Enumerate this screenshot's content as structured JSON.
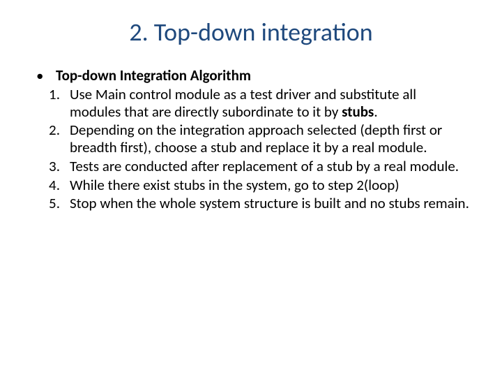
{
  "title": "2. Top-down integration",
  "intro_bullet": "Top-down Integration Algorithm",
  "steps": [
    {
      "n": "1.",
      "pre": "Use Main control module as a test driver and substitute all modules that are directly subordinate to it by ",
      "bold": "stubs",
      "post": "."
    },
    {
      "n": "2.",
      "pre": "Depending on the integration approach selected (depth first or breadth first), choose a stub and replace it by a real module.",
      "bold": "",
      "post": ""
    },
    {
      "n": "3.",
      "pre": "Tests are conducted after replacement of a stub by a real module.",
      "bold": "",
      "post": ""
    },
    {
      "n": "4.",
      "pre": "While there exist stubs in the system, go to step 2(loop)",
      "bold": "",
      "post": ""
    },
    {
      "n": "5.",
      "pre": "Stop when the whole system structure is built and no stubs remain.",
      "bold": "",
      "post": ""
    }
  ]
}
